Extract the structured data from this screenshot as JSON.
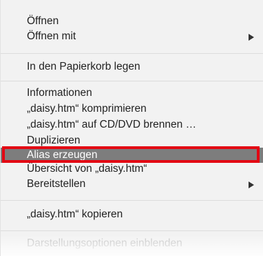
{
  "context_menu": {
    "groups": [
      {
        "items": [
          {
            "label": "Öffnen"
          },
          {
            "label": "Öffnen mit",
            "has_submenu": true
          }
        ]
      },
      {
        "items": [
          {
            "label": "In den Papierkorb legen"
          }
        ]
      },
      {
        "items": [
          {
            "label": "Informationen"
          },
          {
            "label": "„daisy.htm“ komprimieren"
          },
          {
            "label": "„daisy.htm“ auf CD/DVD brennen …"
          },
          {
            "label": "Duplizieren"
          },
          {
            "label": "Alias erzeugen",
            "state": "highlighted"
          },
          {
            "label": "Übersicht von „daisy.htm“"
          },
          {
            "label": "Bereitstellen",
            "has_submenu": true
          }
        ]
      },
      {
        "items": [
          {
            "label": "„daisy.htm“ kopieren"
          }
        ]
      },
      {
        "items": [
          {
            "label": "Darstellungsoptionen einblenden",
            "state": "faded"
          }
        ]
      }
    ]
  },
  "annotation": {
    "highlight_color": "#e30613",
    "target": "Alias erzeugen"
  },
  "colors": {
    "menu_background": "#f2f2f2",
    "selection_background": "#7d7d7d",
    "separator": "#dcdcdc"
  }
}
